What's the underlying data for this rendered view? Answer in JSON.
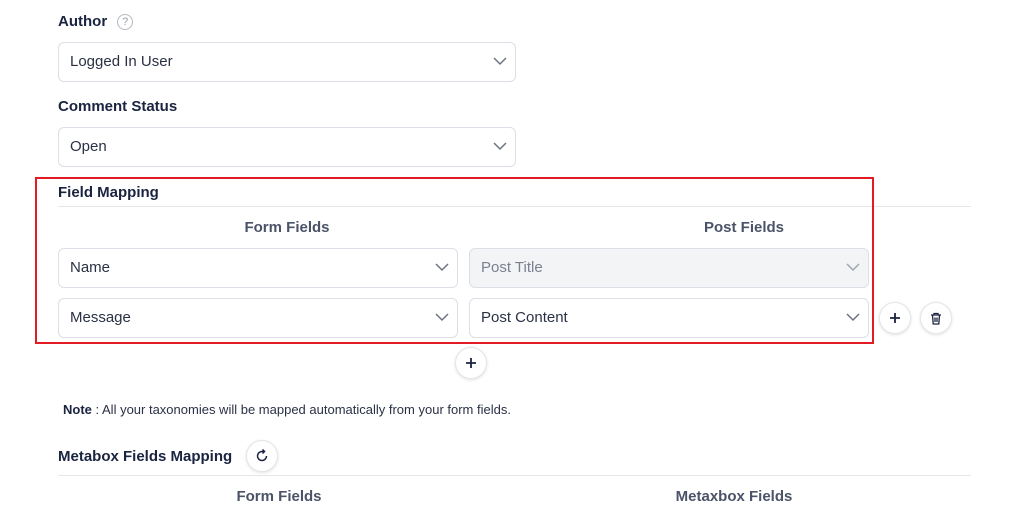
{
  "author": {
    "label": "Author",
    "help": "?",
    "value": "Logged In User"
  },
  "comment_status": {
    "label": "Comment Status",
    "value": "Open"
  },
  "field_mapping": {
    "title": "Field Mapping",
    "col_form": "Form Fields",
    "col_post": "Post Fields",
    "rows": [
      {
        "form_field": "Name",
        "post_field": "Post Title"
      },
      {
        "form_field": "Message",
        "post_field": "Post Content"
      }
    ]
  },
  "note": {
    "prefix": "Note",
    "text": " : All your taxonomies will be mapped automatically from your form fields."
  },
  "metabox": {
    "title": "Metabox Fields Mapping",
    "col_form": "Form Fields",
    "col_meta": "Metaxbox Fields"
  },
  "colors": {
    "highlight": "#e31b23",
    "text": "#1a2340"
  }
}
